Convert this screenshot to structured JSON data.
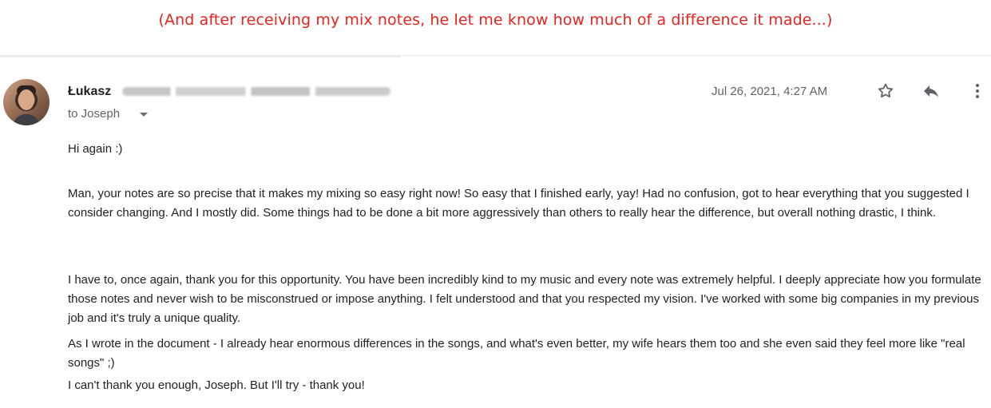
{
  "caption": "(And after receiving my mix notes, he let me know how much of a difference it made...)",
  "email": {
    "sender_name": "Łukasz",
    "recipient": "to Joseph",
    "timestamp": "Jul 26, 2021, 4:27 AM",
    "greeting": "Hi again :)",
    "paragraph_1": "Man, your notes are so precise that it makes my mixing so easy right now! So easy that I finished early, yay! Had no confusion, got to hear everything that you suggested I consider changing. And I mostly did. Some things had to be done a bit more aggressively than others to really hear the difference, but overall nothing drastic, I think.",
    "paragraph_2": "I have to, once again, thank you for this opportunity. You have been incredibly kind to my music and every note was extremely helpful. I deeply appreciate how you formulate those notes and never wish to be misconstrued or impose anything. I felt understood and that you respected my vision. I've worked with some big companies in my previous job and it's truly a unique quality.",
    "paragraph_3": "As I wrote in the document - I already hear enormous differences in the songs, and what's even better, my wife hears them too and she even said they feel more like \"real songs\" ;)",
    "paragraph_4": "I can't thank you enough, Joseph. But I'll try - thank you!"
  },
  "icons": {
    "star": "star-icon",
    "reply": "reply-icon",
    "more": "more-vertical-icon",
    "caret": "chevron-down-icon"
  },
  "colors": {
    "caption": "#e8231e",
    "text": "#222222",
    "muted": "#5f6368"
  }
}
